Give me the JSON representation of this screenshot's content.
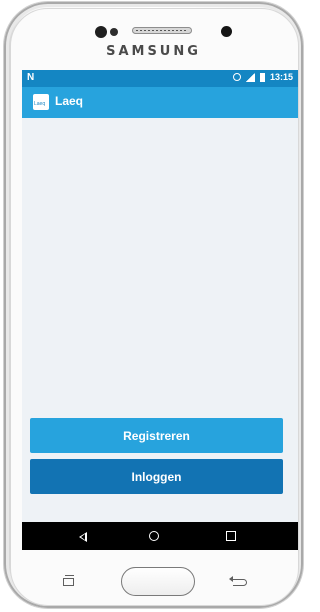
{
  "device": {
    "brand": "SAMSUNG"
  },
  "statusbar": {
    "left_icon": "N",
    "time": "13:15"
  },
  "appbar": {
    "title": "Laeq",
    "logo_text": "Laeq"
  },
  "main": {
    "buttons": {
      "register_label": "Registreren",
      "login_label": "Inloggen"
    }
  },
  "navbar": {
    "back_icon": "back-triangle",
    "home_icon": "circle",
    "recents_icon": "square"
  },
  "colors": {
    "status_bar": "#1486c3",
    "app_bar": "#27a3dd",
    "register_button": "#27a3dd",
    "login_button": "#1273b3",
    "screen_background": "#eef2f6"
  }
}
